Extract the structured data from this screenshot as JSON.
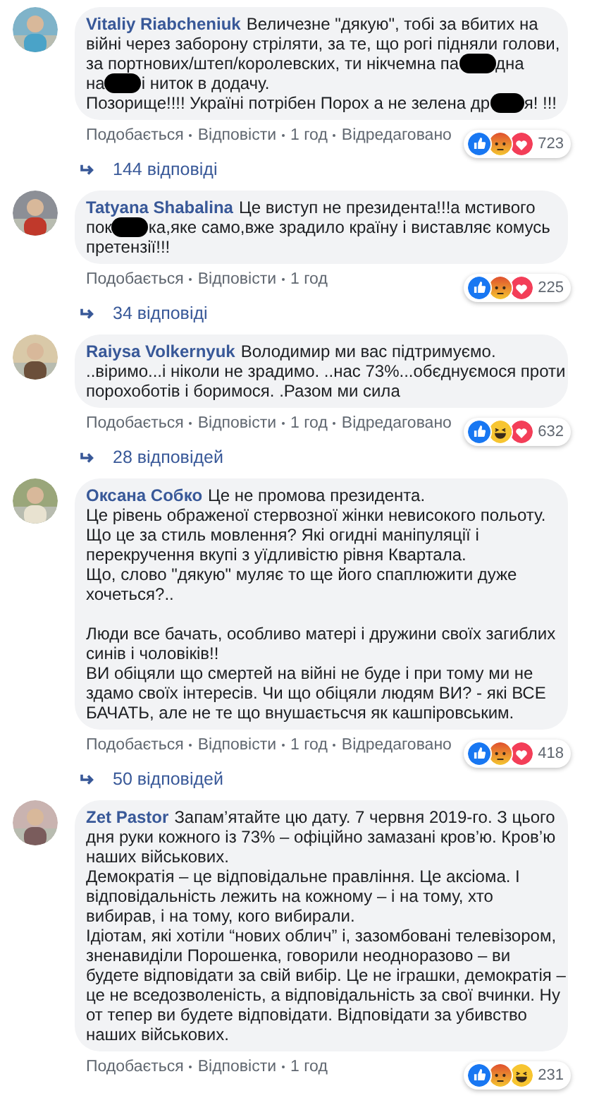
{
  "comments": [
    {
      "author": "Vitaliy Riabcheniuk",
      "paragraphs": [
        [
          "Величезне \"дякую\", тобі за вбитих на",
          "війні через заборону стріляти, за те, що рогі підняли голови,",
          [
            {
              "kind": "text",
              "text": "за портнових/штеп/королевских, ти нікчемна па"
            },
            {
              "kind": "redaction"
            },
            {
              "kind": "text",
              "text": "дна"
            }
          ],
          [
            {
              "kind": "text",
              "text": "на"
            },
            {
              "kind": "redaction"
            },
            {
              "kind": "text",
              "text": "і ниток в додачу."
            }
          ],
          [
            {
              "kind": "text",
              "text": "Позорище!!!! Україні потрібен Порох а не зелена др"
            },
            {
              "kind": "redaction"
            },
            {
              "kind": "text",
              "text": "я! !!!"
            }
          ]
        ]
      ],
      "reactions": [
        {
          "kind": "like"
        },
        {
          "kind": "angry"
        },
        {
          "kind": "love"
        }
      ],
      "count": "723",
      "actions": [
        "Подобається",
        "Відповісти"
      ],
      "time": "1 год",
      "edited": "Відредаговано",
      "replies": "144 відповіді"
    },
    {
      "author": "Tatyana Shabalina",
      "paragraphs": [
        [
          "Це виступ не президента!!!а мстивого",
          [
            {
              "kind": "text",
              "text": "пок"
            },
            {
              "kind": "redaction"
            },
            {
              "kind": "text",
              "text": "ка,яке само,вже зрадило країну і виставляє комусь"
            }
          ],
          "претензії!!!"
        ]
      ],
      "reactions": [
        {
          "kind": "like"
        },
        {
          "kind": "angry"
        },
        {
          "kind": "love"
        }
      ],
      "count": "225",
      "actions": [
        "Подобається",
        "Відповісти"
      ],
      "time": "1 год",
      "replies": "34 відповіді"
    },
    {
      "author": "Raiysa Volkernyuk",
      "paragraphs": [
        [
          "Володимир ми вас підтримуємо.",
          "..віримо...і ніколи не зрадимо. ..нас 73%...обєднуємося проти",
          "порохоботів і боримося. .Разом ми сила"
        ]
      ],
      "reactions": [
        {
          "kind": "like"
        },
        {
          "kind": "haha"
        },
        {
          "kind": "love"
        }
      ],
      "count": "632",
      "actions": [
        "Подобається",
        "Відповісти"
      ],
      "time": "1 год",
      "edited": "Відредаговано",
      "replies": "28 відповідей"
    },
    {
      "author": "Оксана Собко",
      "paragraphs": [
        [
          "Це не промова президента.",
          "Це рівень ображеної стервозної жінки невисокого польоту.",
          "Що це за стиль мовлення? Які огидні маніпуляції і",
          "перекручення вкупі з уїдливістю рівня Квартала.",
          "Що, слово \"дякую\" муляє то ще його спаплюжити дуже",
          "хочеться?.."
        ],
        [
          "Люди все бачать, особливо матері і дружини своїх загиблих",
          "синів і чоловіків!!",
          "ВИ обіцяли що смертей на війні не буде і при тому ми не",
          "здамо своїх інтересів. Чи що обіцяли людям ВИ? - які ВСЕ",
          "БАЧАТЬ, але не те що внушаєтьсчя як кашпіровським."
        ]
      ],
      "reactions": [
        {
          "kind": "like"
        },
        {
          "kind": "angry"
        },
        {
          "kind": "love"
        }
      ],
      "count": "418",
      "actions": [
        "Подобається",
        "Відповісти"
      ],
      "time": "1 год",
      "edited": "Відредаговано",
      "replies": "50 відповідей"
    },
    {
      "author": "Zet Pastor",
      "paragraphs": [
        [
          "Запам’ятайте цю дату. 7 червня 2019-го. З цього",
          "дня руки кожного із 73% – офіційно замазані кров’ю. Кров’ю",
          "наших військових.",
          "Демократія – це відповідальне правління. Це аксіома. І",
          "відповідальність лежить на кожному – і на тому, хто",
          "вибирав, і на тому, кого вибирали.",
          "Ідіотам, які хотіли “нових облич” і, зазомбовані телевізором,",
          "зненавиділи Порошенка, говорили неодноразово – ви",
          "будете відповідати за свій вибір. Це не іграшки, демократія –",
          "це не вседозволеність, а відповідальність за свої вчинки. Ну",
          "от тепер ви будете відповідати. Відповідати за убивство",
          "наших військових."
        ]
      ],
      "reactions": [
        {
          "kind": "like"
        },
        {
          "kind": "angry"
        },
        {
          "kind": "haha"
        }
      ],
      "count": "231",
      "actions": [
        "Подобається",
        "Відповісти"
      ],
      "time": "1 год"
    }
  ]
}
